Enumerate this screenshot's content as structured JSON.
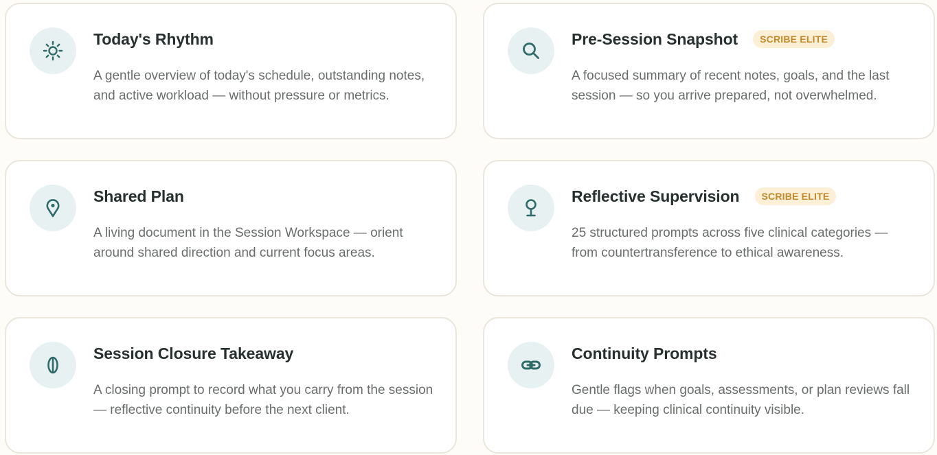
{
  "colors": {
    "accent": "#2f6b68",
    "icon_bg": "#e8f1f1",
    "badge_bg": "#fbefd6",
    "badge_text": "#c48a2a"
  },
  "cards": [
    {
      "icon": "sun-icon",
      "title": "Today's Rhythm",
      "badge": "",
      "description": "A gentle overview of today's schedule, outstanding notes, and active workload — without pressure or metrics."
    },
    {
      "icon": "search-icon",
      "title": "Pre-Session Snapshot",
      "badge": "SCRIBE ELITE",
      "description": "A focused summary of recent notes, goals, and the last session — so you arrive prepared, not overwhelmed."
    },
    {
      "icon": "map-pin-icon",
      "title": "Shared Plan",
      "badge": "",
      "description": "A living document in the Session Workspace — orient around shared direction and current focus areas."
    },
    {
      "icon": "lollipop-icon",
      "title": "Reflective Supervision",
      "badge": "SCRIBE ELITE",
      "description": "25 structured prompts across five clinical categories — from countertransference to ethical awareness."
    },
    {
      "icon": "leaf-icon",
      "title": "Session Closure Takeaway",
      "badge": "",
      "description": "A closing prompt to record what you carry from the session — reflective continuity before the next client."
    },
    {
      "icon": "link-icon",
      "title": "Continuity Prompts",
      "badge": "",
      "description": "Gentle flags when goals, assessments, or plan reviews fall due — keeping clinical continuity visible."
    }
  ]
}
